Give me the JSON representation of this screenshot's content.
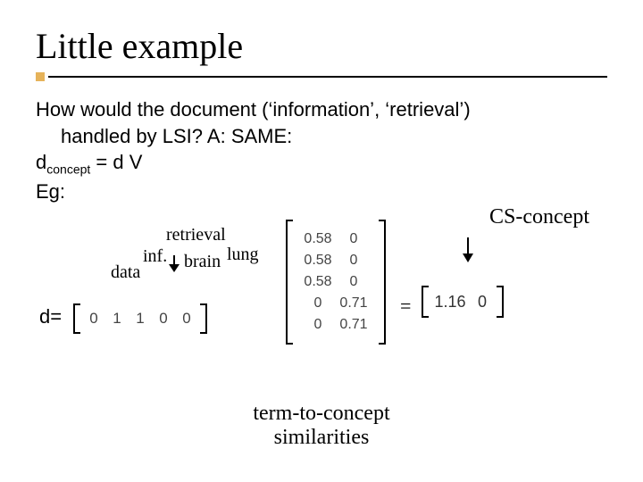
{
  "title": "Little example",
  "body": {
    "line1": "How would the document (‘information’, ‘retrieval’)",
    "line2": "handled by LSI? A: SAME:",
    "formula_pre": "d",
    "formula_sub": "concept",
    "formula_post": " = d V",
    "eg": "Eg:"
  },
  "words": {
    "retrieval": "retrieval",
    "inf": "inf.",
    "brain": "brain",
    "lung": "lung",
    "data": "data"
  },
  "d_label": "d=",
  "cs_label": "CS-concept",
  "eq": "=",
  "matrix_d": [
    "0",
    "1",
    "1",
    "0",
    "0"
  ],
  "matrix_V": [
    [
      "0.58",
      "0"
    ],
    [
      "0.58",
      "0"
    ],
    [
      "0.58",
      "0"
    ],
    [
      "0",
      "0.71"
    ],
    [
      "0",
      "0.71"
    ]
  ],
  "matrix_R": [
    "1.16",
    "0"
  ],
  "caption1": "term-to-concept",
  "caption2": "similarities"
}
